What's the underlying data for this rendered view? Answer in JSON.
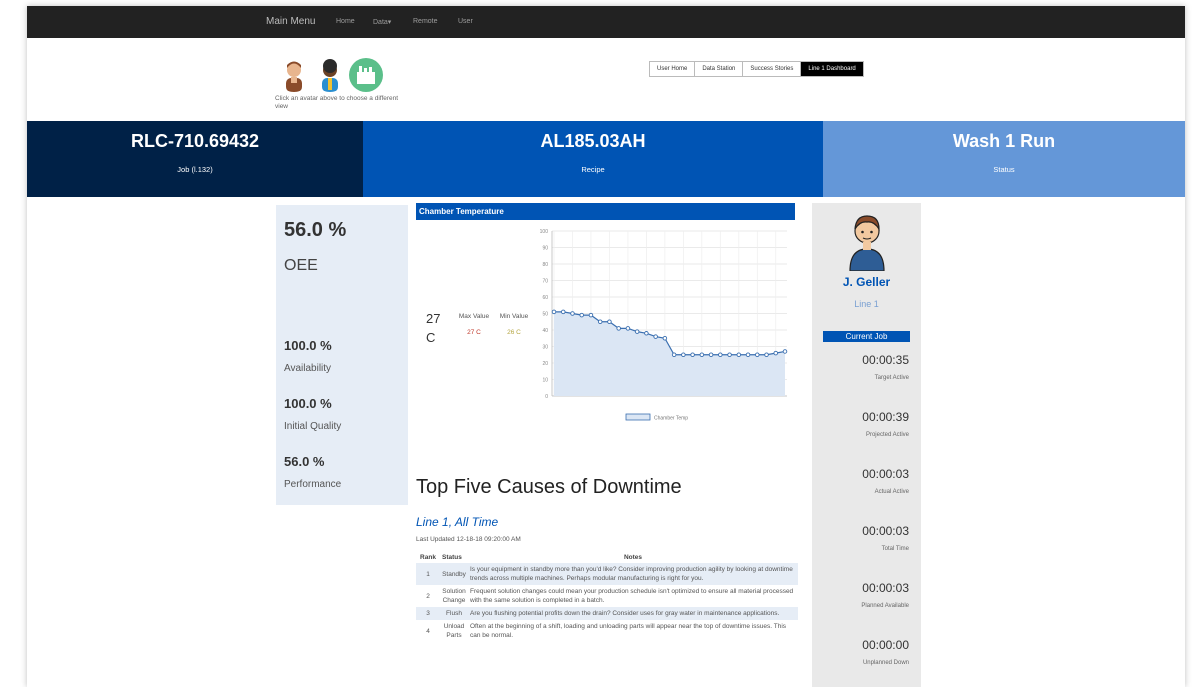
{
  "nav": {
    "brand": "Main Menu",
    "links": [
      "Home",
      "Data▾",
      "Remote",
      "User"
    ]
  },
  "header": {
    "avatar_hint": "Click an avatar above to choose a different view",
    "tabs": [
      "User Home",
      "Data Station",
      "Success Stories",
      "Line 1 Dashboard"
    ],
    "active_tab": "Line 1 Dashboard"
  },
  "band": {
    "job_value": "RLC-710.69432",
    "job_label": "Job (l.132)",
    "recipe_value": "AL185.03AH",
    "recipe_label": "Recipe",
    "status_value": "Wash 1 Run",
    "status_label": "Status"
  },
  "metrics": {
    "oee_value": "56.0 %",
    "oee_label": "OEE",
    "availability_value": "100.0 %",
    "availability_label": "Availability",
    "quality_value": "100.0 %",
    "quality_label": "Initial Quality",
    "performance_value": "56.0 %",
    "performance_label": "Performance"
  },
  "chamber": {
    "title": "Chamber Temperature",
    "current_value": "27",
    "current_unit": "C",
    "max_label": "Max Value",
    "min_label": "Min Value",
    "max_value": "27 C",
    "min_value": "26 C",
    "max_color": "#c0392b",
    "min_color": "#b5a642"
  },
  "chart_data": {
    "type": "line",
    "title": "Chamber Temperature",
    "xlabel": "",
    "ylabel": "",
    "ylim": [
      0,
      100
    ],
    "yticks": [
      0,
      10,
      20,
      30,
      40,
      50,
      60,
      70,
      80,
      90,
      100
    ],
    "grid": true,
    "legend": "bottom",
    "series": [
      {
        "name": "Chamber Temp",
        "color": "#3a6fb0",
        "fill": "#dbe6f4",
        "values": [
          51,
          51,
          50,
          49,
          49,
          45,
          45,
          41,
          41,
          39,
          38,
          36,
          35,
          25,
          25,
          25,
          25,
          25,
          25,
          25,
          25,
          25,
          25,
          25,
          26,
          27
        ]
      }
    ]
  },
  "downtime": {
    "title": "Top Five Causes of Downtime",
    "subtitle": "Line 1, All Time",
    "updated": "Last Updated 12-18-18 09:20:00 AM",
    "columns": [
      "Rank",
      "Status",
      "Notes"
    ],
    "rows": [
      {
        "rank": "1",
        "status": "Standby",
        "notes": "Is your equipment in standby more than you'd like? Consider improving production agility by looking at downtime trends across multiple machines. Perhaps modular manufacturing is right for you."
      },
      {
        "rank": "2",
        "status": "Solution Change",
        "notes": "Frequent solution changes could mean your production schedule isn't optimized to ensure all material processed with the same solution is completed in a batch."
      },
      {
        "rank": "3",
        "status": "Flush",
        "notes": "Are you flushing potential profits down the drain? Consider uses for gray water in maintenance applications."
      },
      {
        "rank": "4",
        "status": "Unload Parts",
        "notes": "Often at the beginning of a shift, loading and unloading parts will appear near the top of downtime issues. This can be normal."
      }
    ]
  },
  "operator": {
    "name": "J. Geller",
    "line": "Line 1",
    "current_job_label": "Current Job",
    "timers": [
      {
        "value": "00:00:35",
        "label": "Target Active"
      },
      {
        "value": "00:00:39",
        "label": "Projected Active"
      },
      {
        "value": "00:00:03",
        "label": "Actual Active"
      },
      {
        "value": "00:00:03",
        "label": "Total Time"
      },
      {
        "value": "00:00:03",
        "label": "Planned Available"
      },
      {
        "value": "00:00:00",
        "label": "Unplanned Down"
      }
    ]
  },
  "colors": {
    "nav_bg": "#222222",
    "job_bg": "#002147",
    "recipe_bg": "#0054b4",
    "status_bg": "#6497d8",
    "panel_bg": "#e6edf6"
  }
}
